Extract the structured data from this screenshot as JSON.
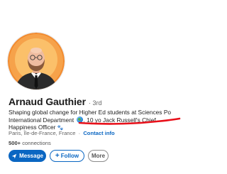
{
  "profile": {
    "name": "Arnaud Gauthier",
    "degree": "· 3rd",
    "headline_part1": "Shaping global change for Higher Ed students at Sciences Po International Department",
    "headline_part2": ". 10 yo Jack Russell's Chief Happiness Officer",
    "location": "Paris, Île-de-France, France",
    "separator": "·",
    "contact_info": "Contact info",
    "connections_count": "500+",
    "connections_label": "connections",
    "globe_icon": "globe-icon",
    "paw_icon": "paw-print-icon"
  },
  "actions": {
    "message_label": "Message",
    "follow_label": "Follow",
    "more_label": "More"
  },
  "colors": {
    "brand_blue": "#0a66c2",
    "underline_red": "#e8101a",
    "avatar_ring": "#f36f21"
  }
}
